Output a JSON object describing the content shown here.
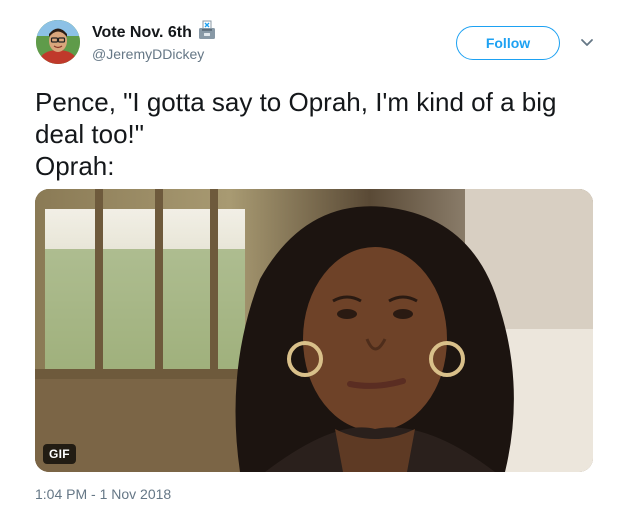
{
  "author": {
    "display_name": "Vote Nov. 6th",
    "handle": "@JeremyDDickey",
    "name_icon": "ballot-box-icon"
  },
  "follow_button": {
    "label": "Follow"
  },
  "menu": {
    "icon": "chevron-down-icon"
  },
  "tweet": {
    "lines": [
      "Pence, \"I gotta say to Oprah, I'm kind of a big",
      "deal too!\"",
      "Oprah:"
    ]
  },
  "media": {
    "badge": "GIF"
  },
  "meta": {
    "timestamp": "1:04 PM - 1 Nov 2018"
  },
  "colors": {
    "accent": "#1da1f2",
    "secondary_text": "#657786",
    "primary_text": "#14171a"
  }
}
